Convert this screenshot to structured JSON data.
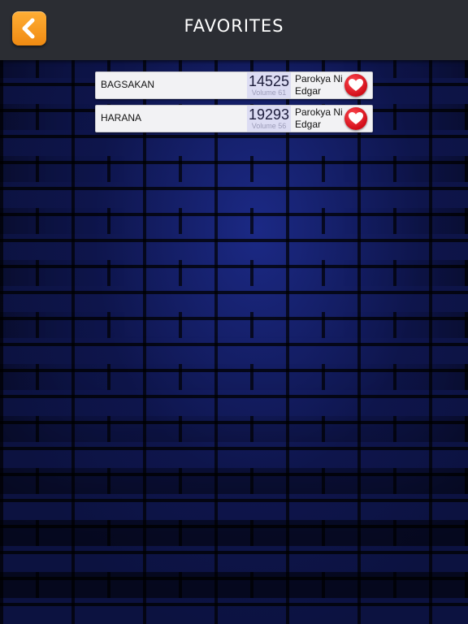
{
  "header": {
    "title": "FAVORITES",
    "back_icon": "chevron-left-icon",
    "back_color": "#f59a1b"
  },
  "favorites": [
    {
      "song": "BAGSAKAN",
      "number": "14525",
      "volume": "Volume 61",
      "artist": "Parokya Ni Edgar",
      "icon": "heart-icon"
    },
    {
      "song": "HARANA",
      "number": "19293",
      "volume": "Volume 56",
      "artist": "Parokya Ni Edgar",
      "icon": "heart-icon"
    }
  ],
  "colors": {
    "header_bg": "#2b2d33",
    "heart": "#d10d18",
    "number_box": "#dcdcf3",
    "wall": "#0c1240"
  }
}
